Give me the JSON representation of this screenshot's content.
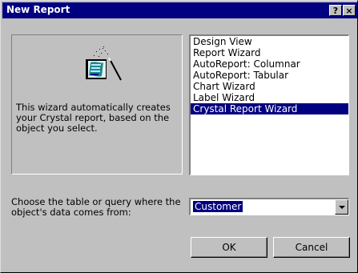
{
  "window": {
    "title": "New Report",
    "help_label": "?",
    "close_label": "×"
  },
  "info": {
    "description": "This wizard automatically creates your Crystal report, based on the object you select."
  },
  "report_types": {
    "items": [
      {
        "label": "Design View",
        "selected": false
      },
      {
        "label": "Report Wizard",
        "selected": false
      },
      {
        "label": "AutoReport:  Columnar",
        "selected": false
      },
      {
        "label": "AutoReport:  Tabular",
        "selected": false
      },
      {
        "label": "Chart Wizard",
        "selected": false
      },
      {
        "label": "Label Wizard",
        "selected": false
      },
      {
        "label": "Crystal Report Wizard",
        "selected": true
      }
    ]
  },
  "source": {
    "prompt": "Choose the table or query where the object's data comes from:",
    "value": "Customer"
  },
  "buttons": {
    "ok_label": "OK",
    "cancel_label": "Cancel"
  },
  "colors": {
    "title_bar": "#000080",
    "selection": "#000080",
    "face": "#c0c0c0"
  },
  "icons": {
    "wizard": "crystal-report-wizard-icon",
    "combo_arrow": "chevron-down-icon"
  }
}
